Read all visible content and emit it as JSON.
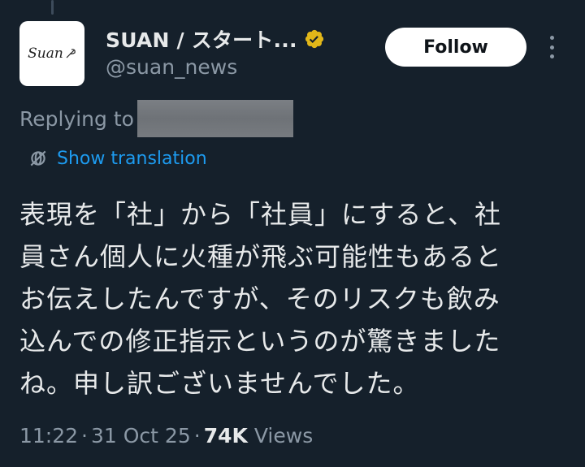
{
  "author": {
    "display_name": "SUAN / スタート...",
    "handle": "@suan_news",
    "avatar_text": "Suan"
  },
  "actions": {
    "follow_label": "Follow"
  },
  "reply": {
    "prefix": "Replying to"
  },
  "translation": {
    "label": "Show translation"
  },
  "tweet": {
    "text": "表現を「社」から「社員」にすると、社\n員さん個人に火種が飛ぶ可能性もあると\nお伝えしたんですが、そのリスクも飲み\n込んでの修正指示というのが驚きました\nね。申し訳ございませんでした。"
  },
  "meta": {
    "time": "11:22",
    "date": "31 Oct 25",
    "views_count": "74K",
    "views_label": "Views",
    "separator": "·"
  },
  "colors": {
    "background": "#15202b",
    "link": "#1d9bf0",
    "verified_badge": "#e2b719",
    "muted_text": "#8b98a5"
  },
  "icons": [
    "verified-badge-icon",
    "more-options-icon",
    "translate-globe-icon"
  ]
}
